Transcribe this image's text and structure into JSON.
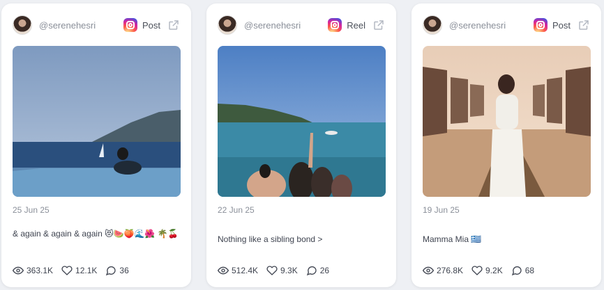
{
  "posts": [
    {
      "handle": "@serenehesri",
      "type": "Post",
      "date": "25 Jun 25",
      "caption": "& again & again & again 😻🍉🍑🌊🌺 🌴🍒",
      "views": "363.1K",
      "likes": "12.1K",
      "comments": "36"
    },
    {
      "handle": "@serenehesri",
      "type": "Reel",
      "date": "22 Jun 25",
      "caption": "Nothing like a sibling bond >",
      "views": "512.4K",
      "likes": "9.3K",
      "comments": "26"
    },
    {
      "handle": "@serenehesri",
      "type": "Post",
      "date": "19 Jun 25",
      "caption": "Mamma Mia 🇬🇷",
      "views": "276.8K",
      "likes": "9.2K",
      "comments": "68"
    }
  ],
  "colors": {
    "accent_icon": "#d6249f",
    "text_muted": "#8a8f99",
    "text_main": "#3f4450"
  }
}
